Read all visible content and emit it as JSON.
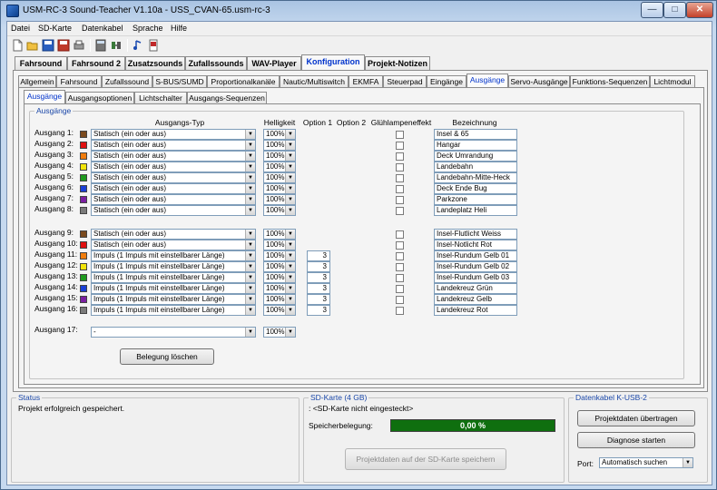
{
  "window": {
    "title": "USM-RC-3 Sound-Teacher V1.10a - USS_CVAN-65.usm-rc-3"
  },
  "menu": [
    "Datei",
    "SD-Karte",
    "Datenkabel",
    "Sprache",
    "Hilfe"
  ],
  "tabs_main": [
    "Fahrsound",
    "Fahrsound 2",
    "Zusatzsounds",
    "Zufallssounds",
    "WAV-Player",
    "Konfiguration",
    "Projekt-Notizen"
  ],
  "tabs_sub": [
    "Allgemein",
    "Fahrsound",
    "Zufallssound",
    "S-BUS/SUMD",
    "Proportionalkanäle",
    "Nautic/Multiswitch",
    "EKMFA",
    "Steuerpad",
    "Eingänge",
    "Ausgänge",
    "Servo-Ausgänge",
    "Funktions-Sequenzen",
    "Lichtmodul"
  ],
  "tabs_third": [
    "Ausgänge",
    "Ausgangsoptionen",
    "Lichtschalter",
    "Ausgangs-Sequenzen"
  ],
  "group_outputs": {
    "title": "Ausgänge",
    "headers": {
      "type": "Ausgangs-Typ",
      "brightness": "Helligkeit",
      "option1": "Option 1",
      "option2": "Option 2",
      "glow": "Glühlampeneffekt",
      "name": "Bezeichnung"
    },
    "rows": [
      {
        "label": "Ausgang 1:",
        "color": "#7a4a1e",
        "type": "Statisch (ein oder aus)",
        "brightness": "100%",
        "option1": "",
        "name": "Insel & 65"
      },
      {
        "label": "Ausgang 2:",
        "color": "#e01010",
        "type": "Statisch (ein oder aus)",
        "brightness": "100%",
        "option1": "",
        "name": "Hangar"
      },
      {
        "label": "Ausgang 3:",
        "color": "#f07c0c",
        "type": "Statisch (ein oder aus)",
        "brightness": "100%",
        "option1": "",
        "name": "Deck Umrandung"
      },
      {
        "label": "Ausgang 4:",
        "color": "#f2e40a",
        "type": "Statisch (ein oder aus)",
        "brightness": "100%",
        "option1": "",
        "name": "Landebahn"
      },
      {
        "label": "Ausgang 5:",
        "color": "#1f9a1f",
        "type": "Statisch (ein oder aus)",
        "brightness": "100%",
        "option1": "",
        "name": "Landebahn-Mitte-Heck"
      },
      {
        "label": "Ausgang 6:",
        "color": "#1a3fd6",
        "type": "Statisch (ein oder aus)",
        "brightness": "100%",
        "option1": "",
        "name": "Deck Ende Bug"
      },
      {
        "label": "Ausgang 7:",
        "color": "#7a1fa0",
        "type": "Statisch (ein oder aus)",
        "brightness": "100%",
        "option1": "",
        "name": "Parkzone"
      },
      {
        "label": "Ausgang 8:",
        "color": "#7a7a7a",
        "type": "Statisch (ein oder aus)",
        "brightness": "100%",
        "option1": "",
        "name": "Landeplatz Heli"
      },
      {
        "label": "Ausgang 9:",
        "color": "#7a4a1e",
        "type": "Statisch (ein oder aus)",
        "brightness": "100%",
        "option1": "",
        "name": "Insel-Flutlicht Weiss"
      },
      {
        "label": "Ausgang 10:",
        "color": "#e01010",
        "type": "Statisch (ein oder aus)",
        "brightness": "100%",
        "option1": "",
        "name": "Insel-Notlicht Rot"
      },
      {
        "label": "Ausgang 11:",
        "color": "#f07c0c",
        "type": "Impuls (1 Impuls mit einstellbarer Länge)",
        "brightness": "100%",
        "option1": "3",
        "name": "Insel-Rundum Gelb 01"
      },
      {
        "label": "Ausgang 12:",
        "color": "#f2e40a",
        "type": "Impuls (1 Impuls mit einstellbarer Länge)",
        "brightness": "100%",
        "option1": "3",
        "name": "Insel-Rundum Gelb 02"
      },
      {
        "label": "Ausgang 13:",
        "color": "#1f9a1f",
        "type": "Impuls (1 Impuls mit einstellbarer Länge)",
        "brightness": "100%",
        "option1": "3",
        "name": "Insel-Rundum Gelb 03"
      },
      {
        "label": "Ausgang 14:",
        "color": "#1a3fd6",
        "type": "Impuls (1 Impuls mit einstellbarer Länge)",
        "brightness": "100%",
        "option1": "3",
        "name": "Landekreuz Grün"
      },
      {
        "label": "Ausgang 15:",
        "color": "#7a1fa0",
        "type": "Impuls (1 Impuls mit einstellbarer Länge)",
        "brightness": "100%",
        "option1": "3",
        "name": "Landekreuz Gelb"
      },
      {
        "label": "Ausgang 16:",
        "color": "#7a7a7a",
        "type": "Impuls (1 Impuls mit einstellbarer Länge)",
        "brightness": "100%",
        "option1": "3",
        "name": "Landekreuz Rot"
      }
    ],
    "row17": {
      "label": "Ausgang 17:",
      "type": "-",
      "brightness": "100%"
    },
    "clear_button": "Belegung löschen"
  },
  "status": {
    "title": "Status",
    "text": "Projekt erfolgreich gespeichert."
  },
  "sdcard": {
    "title": "SD-Karte (4 GB)",
    "card_status": ": <SD-Karte nicht eingesteckt>",
    "usage_label": "Speicherbelegung:",
    "usage_value": "0,00 %",
    "usage_fraction": 0,
    "save_button": "Projektdaten auf der SD-Karte speichern"
  },
  "cable": {
    "title": "Datenkabel K-USB-2",
    "transfer_button": "Projektdaten übertragen",
    "diagnose_button": "Diagnose starten",
    "port_label": "Port:",
    "port_value": "Automatisch suchen"
  }
}
